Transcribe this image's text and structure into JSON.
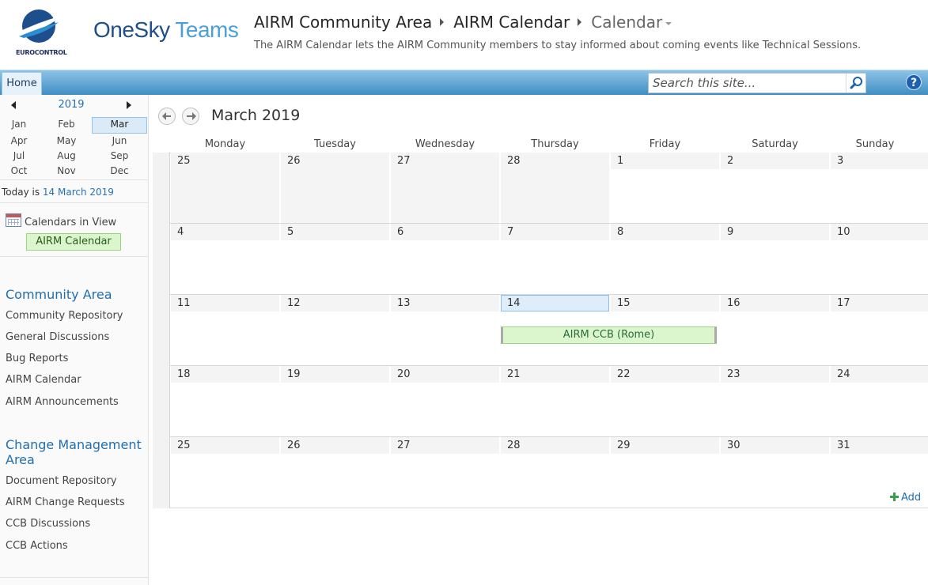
{
  "header": {
    "logo_caption": "EUROCONTROL",
    "brand_one": "OneSky",
    "brand_teams": "Teams",
    "breadcrumb": [
      "AIRM Community Area",
      "AIRM Calendar",
      "Calendar"
    ],
    "description": "The AIRM Calendar lets the AIRM Community members to stay informed about coming events like Technical Sessions."
  },
  "ribbon": {
    "home_tab": "Home",
    "search_placeholder": "Search this site...",
    "help_label": "?"
  },
  "date_picker": {
    "year": "2019",
    "months": [
      "Jan",
      "Feb",
      "Mar",
      "Apr",
      "May",
      "Jun",
      "Jul",
      "Aug",
      "Sep",
      "Oct",
      "Nov",
      "Dec"
    ],
    "selected_month": "Mar"
  },
  "today": {
    "prefix": "Today is ",
    "date": "14 March 2019"
  },
  "calendars_in_view": {
    "label": "Calendars in View",
    "items": [
      "AIRM Calendar"
    ]
  },
  "nav": {
    "community_heading": "Community Area",
    "community_links": [
      "Community Repository",
      "General Discussions",
      "Bug Reports",
      "AIRM Calendar",
      "AIRM Announcements"
    ],
    "change_heading_line1": "Change Management",
    "change_heading_line2": "Area",
    "change_links": [
      "Document Repository",
      "AIRM Change Requests",
      "CCB Discussions",
      "CCB Actions"
    ]
  },
  "calendar": {
    "month_title": "March 2019",
    "weekdays": [
      "Monday",
      "Tuesday",
      "Wednesday",
      "Thursday",
      "Friday",
      "Saturday",
      "Sunday"
    ],
    "weeks": [
      [
        "25",
        "26",
        "27",
        "28",
        "1",
        "2",
        "3"
      ],
      [
        "4",
        "5",
        "6",
        "7",
        "8",
        "9",
        "10"
      ],
      [
        "11",
        "12",
        "13",
        "14",
        "15",
        "16",
        "17"
      ],
      [
        "18",
        "19",
        "20",
        "21",
        "22",
        "23",
        "24"
      ],
      [
        "25",
        "26",
        "27",
        "28",
        "29",
        "30",
        "31"
      ]
    ],
    "today_day": "14",
    "events": [
      {
        "title": "AIRM CCB (Rome)",
        "start": "21",
        "end": "22"
      }
    ],
    "add_label": "Add"
  },
  "colors": {
    "accent": "#2672b5",
    "event_bg": "#dbf6cd",
    "ribbon_top": "#8dc3e6",
    "ribbon_bottom": "#3f8ec4"
  }
}
